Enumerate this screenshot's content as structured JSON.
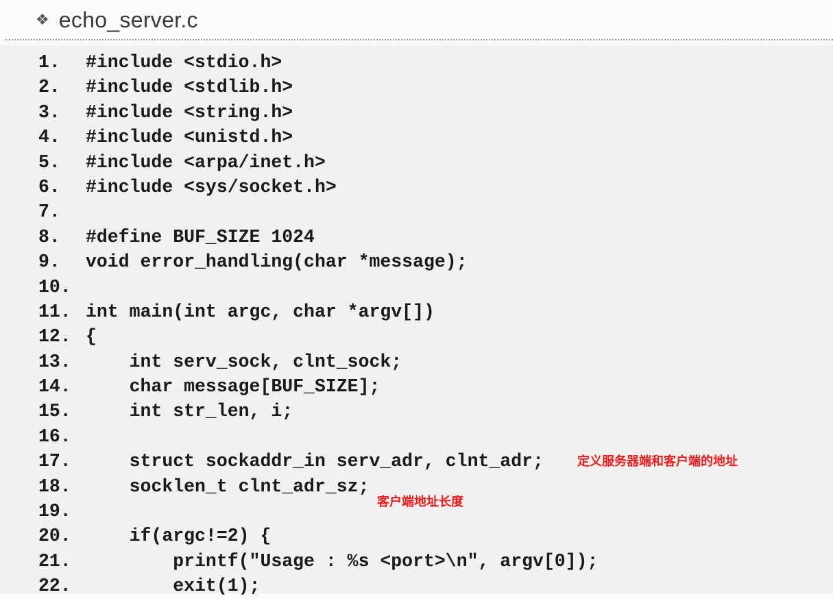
{
  "header": {
    "bullet_icon": "diamond-bullet-icon",
    "title": "echo_server.c"
  },
  "code_lines": [
    {
      "num": "1.",
      "text": "#include <stdio.h>"
    },
    {
      "num": "2.",
      "text": "#include <stdlib.h>"
    },
    {
      "num": "3.",
      "text": "#include <string.h>"
    },
    {
      "num": "4.",
      "text": "#include <unistd.h>"
    },
    {
      "num": "5.",
      "text": "#include <arpa/inet.h>"
    },
    {
      "num": "6.",
      "text": "#include <sys/socket.h>"
    },
    {
      "num": "7.",
      "text": ""
    },
    {
      "num": "8.",
      "text": "#define BUF_SIZE 1024"
    },
    {
      "num": "9.",
      "text": "void error_handling(char *message);"
    },
    {
      "num": "10.",
      "text": ""
    },
    {
      "num": "11.",
      "text": "int main(int argc, char *argv[])"
    },
    {
      "num": "12.",
      "text": "{"
    },
    {
      "num": "13.",
      "text": "    int serv_sock, clnt_sock;"
    },
    {
      "num": "14.",
      "text": "    char message[BUF_SIZE];"
    },
    {
      "num": "15.",
      "text": "    int str_len, i;"
    },
    {
      "num": "16.",
      "text": ""
    },
    {
      "num": "17.",
      "text": "    struct sockaddr_in serv_adr, clnt_adr;"
    },
    {
      "num": "18.",
      "text": "    socklen_t clnt_adr_sz;"
    },
    {
      "num": "19.",
      "text": ""
    },
    {
      "num": "20.",
      "text": "    if(argc!=2) {"
    },
    {
      "num": "21.",
      "text": "        printf(\"Usage : %s <port>\\n\", argv[0]);"
    },
    {
      "num": "22.",
      "text": "        exit(1);"
    }
  ],
  "annotations": {
    "server_client_addr": "定义服务器端和客户端的地址",
    "client_addr_len": "客户端地址长度"
  },
  "colors": {
    "annotation": "#ee1c1c"
  }
}
